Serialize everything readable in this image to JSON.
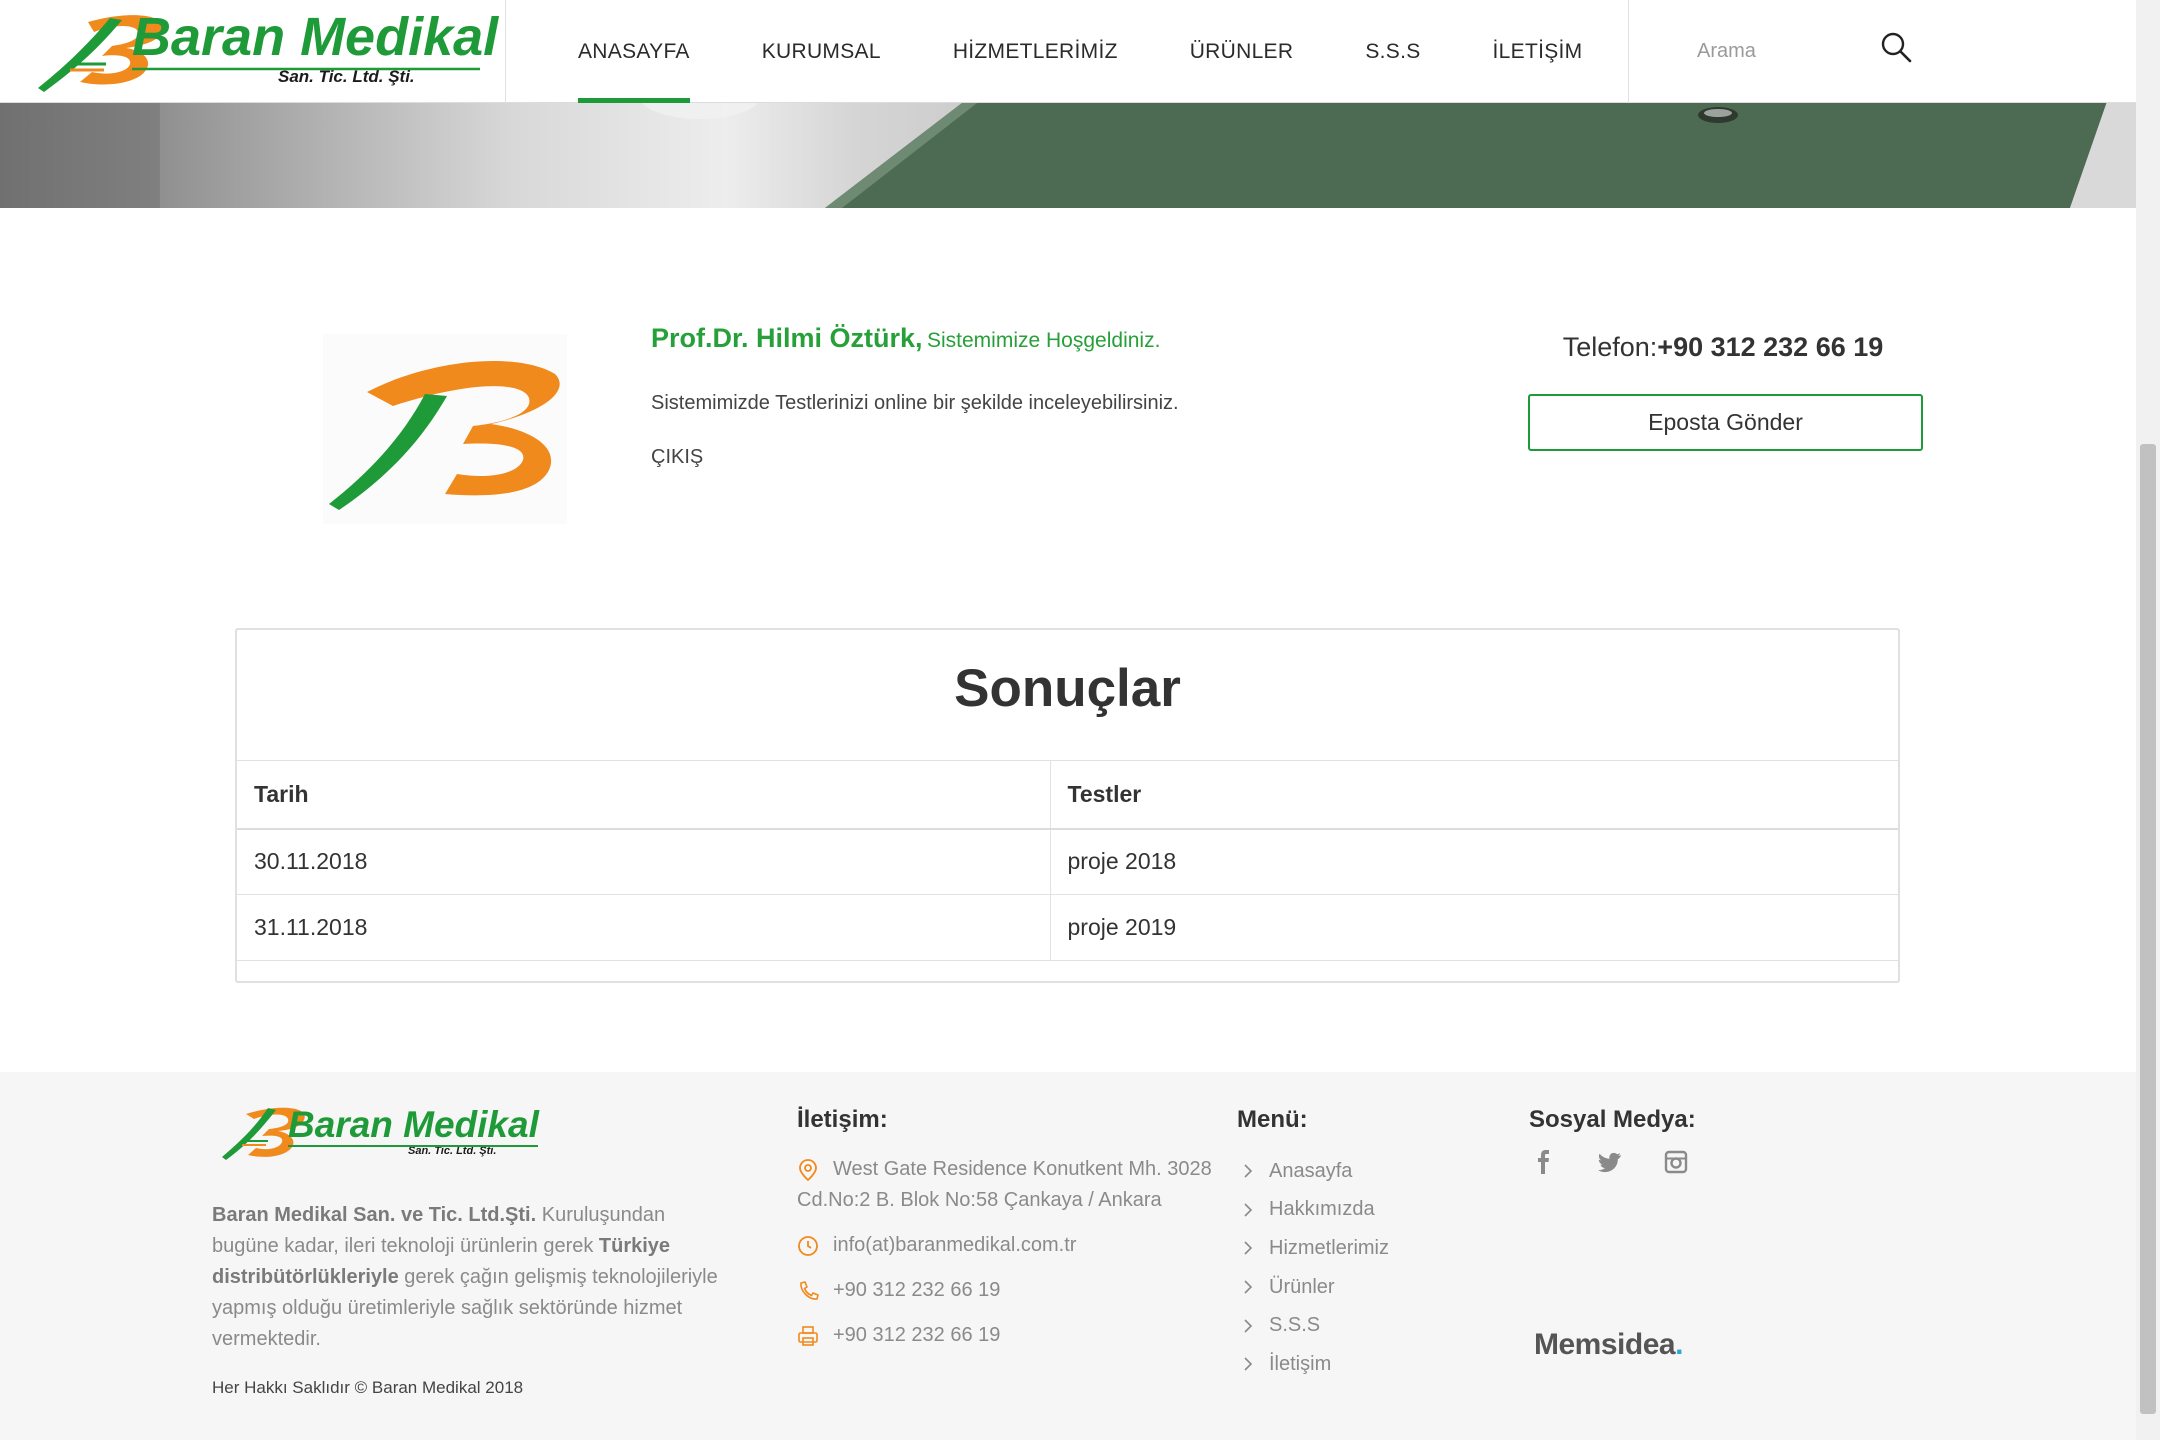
{
  "header": {
    "logo": {
      "brand": "Baran Medikal",
      "sub": "San. Tic. Ltd. Şti."
    },
    "nav": [
      "ANASAYFA",
      "KURUMSAL",
      "HİZMETLERİMİZ",
      "ÜRÜNLER",
      "S.S.S",
      "İLETİŞİM"
    ],
    "active_nav": "ANASAYFA",
    "search_placeholder": "Arama"
  },
  "profile": {
    "name": "Prof.Dr. Hilmi Öztürk,",
    "welcome": "Sistemimize Hoşgeldiniz.",
    "description": "Sistemimizde Testlerinizi online bir şekilde inceleyebilirsiniz.",
    "logout": "ÇIKIŞ",
    "phone_label": "Telefon:",
    "phone_number": "+90 312 232 66 19",
    "email_button": "Eposta Gönder"
  },
  "results": {
    "title": "Sonuçlar",
    "columns": [
      "Tarih",
      "Testler"
    ],
    "rows": [
      [
        "30.11.2018",
        "proje 2018"
      ],
      [
        "31.11.2018",
        "proje 2019"
      ]
    ]
  },
  "footer": {
    "logo": {
      "brand": "Baran Medikal",
      "sub": "San. Tic. Ltd. Şti."
    },
    "about_company": "Baran Medikal San. ve Tic. Ltd.Şti.",
    "about_1": " Kuruluşundan bugüne kadar, ileri teknoloji ürünlerin gerek ",
    "about_bold": "Türkiye distribütörlükleriyle",
    "about_2": " gerek çağın gelişmiş teknolojileriyle yapmış olduğu üretimleriyle sağlık sektöründe hizmet vermektedir.",
    "copyright": "Her Hakkı Saklıdır © Baran Medikal 2018",
    "contact_title": "İletişim:",
    "address": "West Gate Residence Konutkent Mh. 3028 Cd.No:2 B. Blok No:58 Çankaya / Ankara",
    "email": "info(at)baranmedikal.com.tr",
    "phone": "+90 312 232 66 19",
    "fax": "+90 312 232 66 19",
    "menu_title": "Menü:",
    "menu": [
      "Anasayfa",
      "Hakkımızda",
      "Hizmetlerimiz",
      "Ürünler",
      "S.S.S",
      "İletişim"
    ],
    "social_title": "Sosyal Medya:",
    "social_icons": [
      "facebook-icon",
      "twitter-icon",
      "instagram-icon"
    ],
    "credit": "Memsidea",
    "credit_dot": "."
  },
  "colors": {
    "brand_green": "#1e9a38",
    "brand_orange": "#f08a1c",
    "text": "#333333",
    "muted": "#8a8a8a",
    "footer_bg": "#f6f6f6"
  }
}
